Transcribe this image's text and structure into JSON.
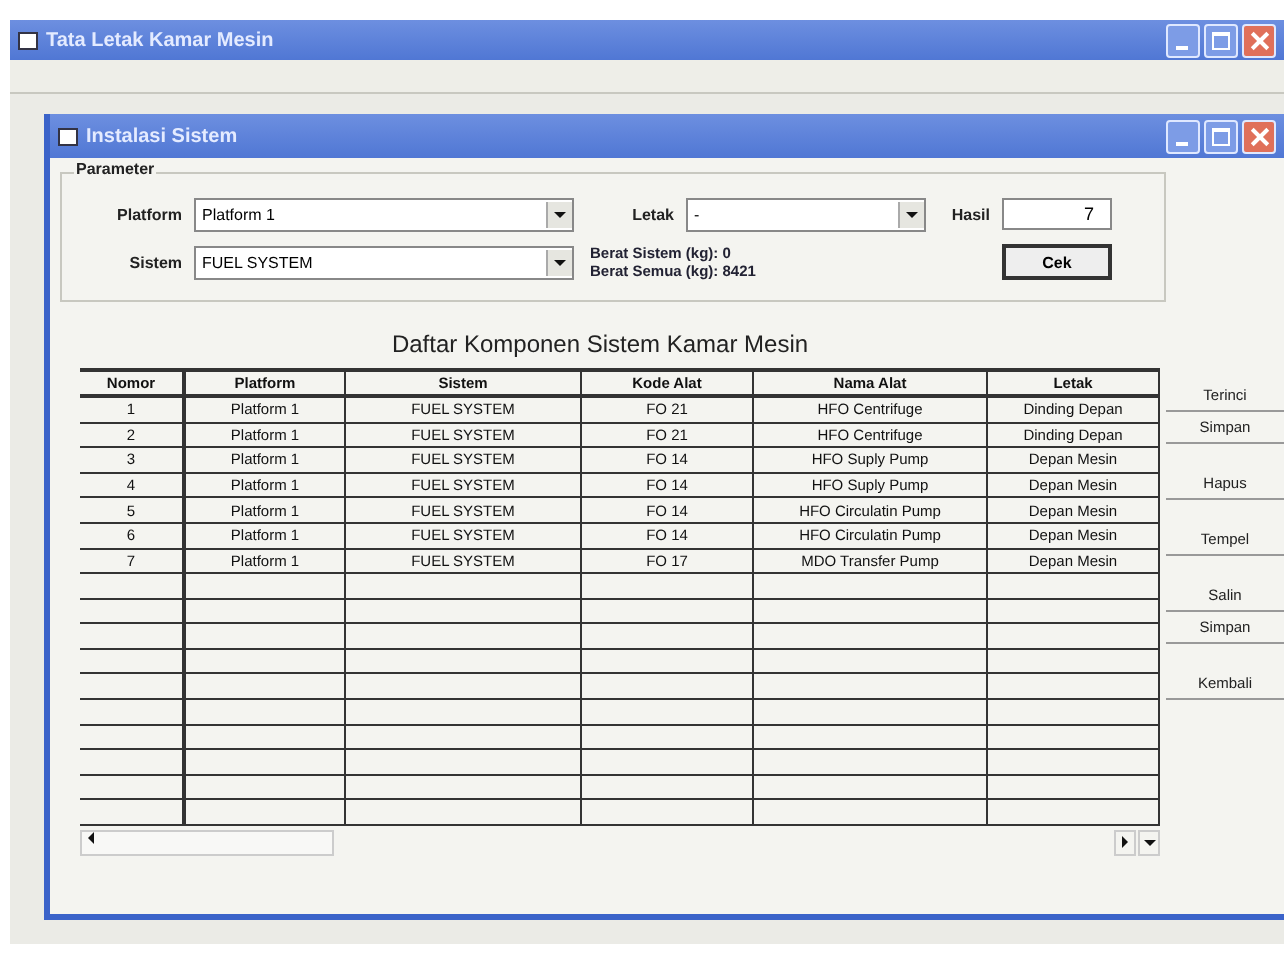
{
  "window": {
    "title": "Tata Letak Kamar Mesin"
  },
  "dialog": {
    "title": "Instalasi Sistem",
    "parameter": {
      "label": "Parameter",
      "platform": {
        "label": "Platform",
        "value": "Platform 1"
      },
      "sistem": {
        "label": "Sistem",
        "value": "FUEL SYSTEM"
      },
      "letak": {
        "label": "Letak",
        "value": "-"
      },
      "berat_sistem": "Berat Sistem (kg): 0",
      "berat_semua": "Berat Semua (kg): 8421",
      "hasil": {
        "label": "Hasil",
        "value": "7"
      },
      "button": "Cek"
    },
    "table": {
      "title": "Daftar Komponen Sistem Kamar Mesin",
      "columns": [
        "Nomor",
        "Platform",
        "Sistem",
        "Kode Alat",
        "Nama Alat",
        "Letak"
      ],
      "rows": [
        [
          "1",
          "Platform 1",
          "FUEL SYSTEM",
          "FO 21",
          "HFO Centrifuge",
          "Dinding Depan"
        ],
        [
          "2",
          "Platform 1",
          "FUEL SYSTEM",
          "FO 21",
          "HFO Centrifuge",
          "Dinding Depan"
        ],
        [
          "3",
          "Platform 1",
          "FUEL SYSTEM",
          "FO 14",
          "HFO Suply Pump",
          "Depan Mesin"
        ],
        [
          "4",
          "Platform 1",
          "FUEL SYSTEM",
          "FO 14",
          "HFO Suply Pump",
          "Depan Mesin"
        ],
        [
          "5",
          "Platform 1",
          "FUEL SYSTEM",
          "FO 14",
          "HFO Circulatin Pump",
          "Depan Mesin"
        ],
        [
          "6",
          "Platform 1",
          "FUEL SYSTEM",
          "FO 14",
          "HFO Circulatin Pump",
          "Depan Mesin"
        ],
        [
          "7",
          "Platform 1",
          "FUEL SYSTEM",
          "FO 17",
          "MDO Transfer Pump",
          "Depan Mesin"
        ]
      ]
    },
    "button_groups": [
      [
        "Terinci",
        "Simpan"
      ],
      [
        "Hapus"
      ],
      [
        "Tempel"
      ],
      [
        "Salin",
        "Simpan"
      ],
      [
        "Kembali"
      ]
    ]
  }
}
